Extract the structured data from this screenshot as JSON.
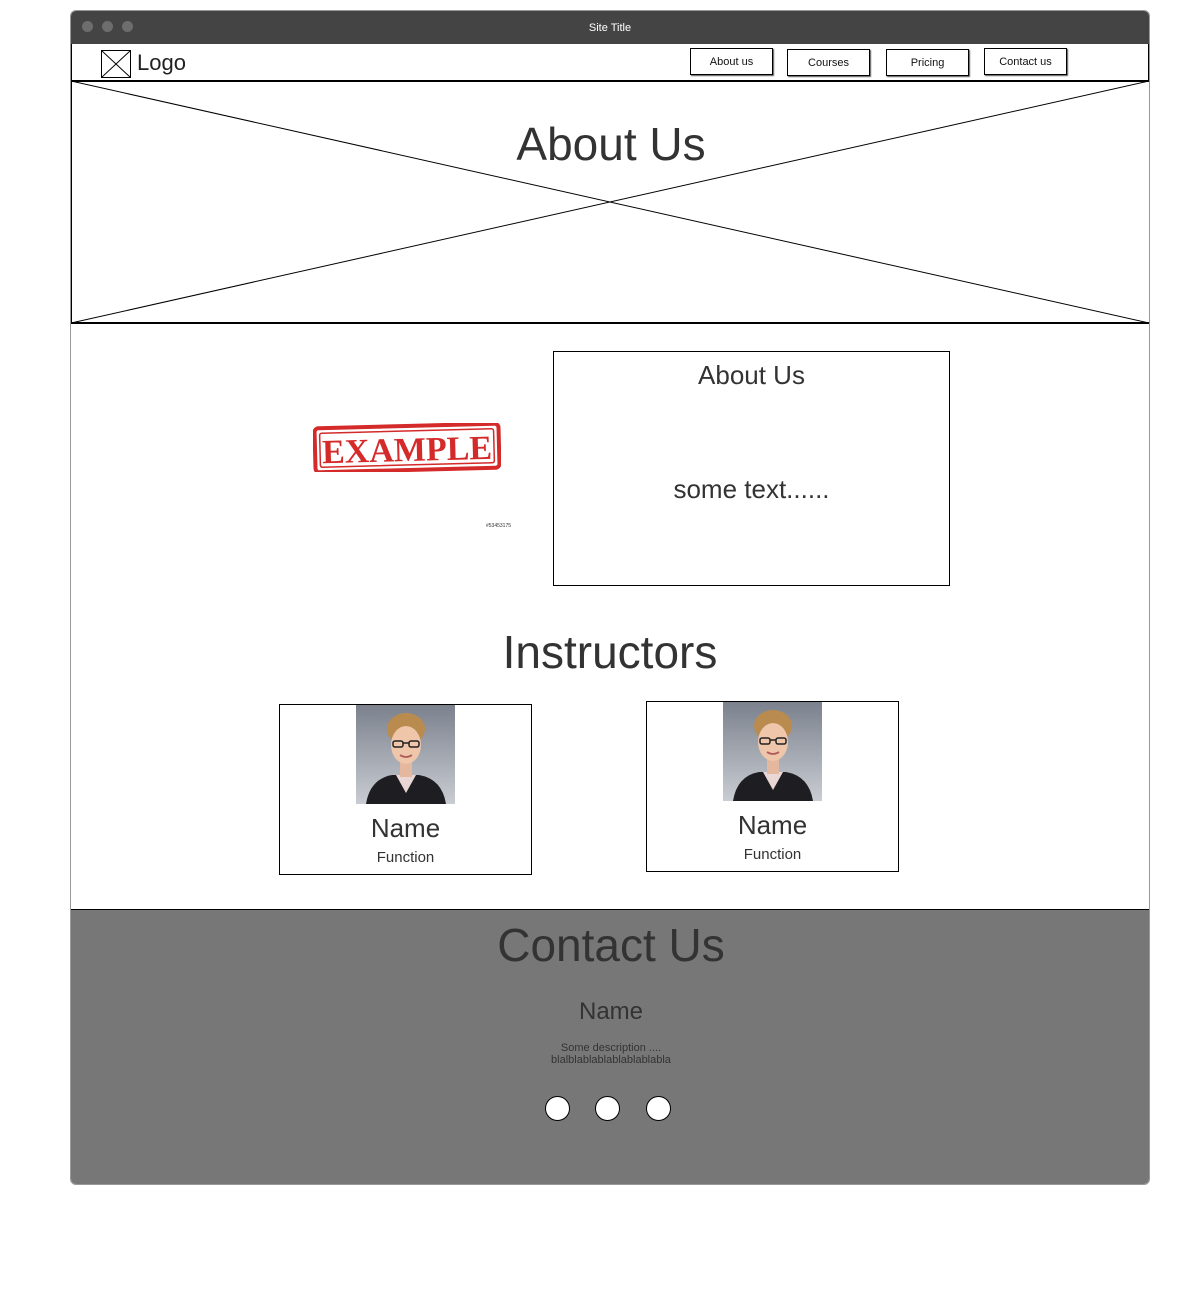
{
  "window": {
    "title": "Site Title"
  },
  "navbar": {
    "logo_text": "Logo",
    "items": [
      {
        "label": "About us"
      },
      {
        "label": "Courses"
      },
      {
        "label": "Pricing"
      },
      {
        "label": "Contact us"
      }
    ]
  },
  "hero": {
    "title": "About Us"
  },
  "about": {
    "stamp_text": "EXAMPLE",
    "stamp_id": "#53453175",
    "box_title": "About Us",
    "box_text": "some text......"
  },
  "instructors": {
    "title": "Instructors",
    "cards": [
      {
        "name": "Name",
        "function": "Function"
      },
      {
        "name": "Name",
        "function": "Function"
      }
    ]
  },
  "contact": {
    "title": "Contact Us",
    "name": "Name",
    "description_line1": "Some description ....",
    "description_line2": "blalblablablablablablabla",
    "social_icons": [
      "social-icon-1",
      "social-icon-2",
      "social-icon-3"
    ]
  },
  "colors": {
    "titlebar": "#444444",
    "contact_bg": "#777777",
    "stamp_red": "#d42a2a"
  }
}
